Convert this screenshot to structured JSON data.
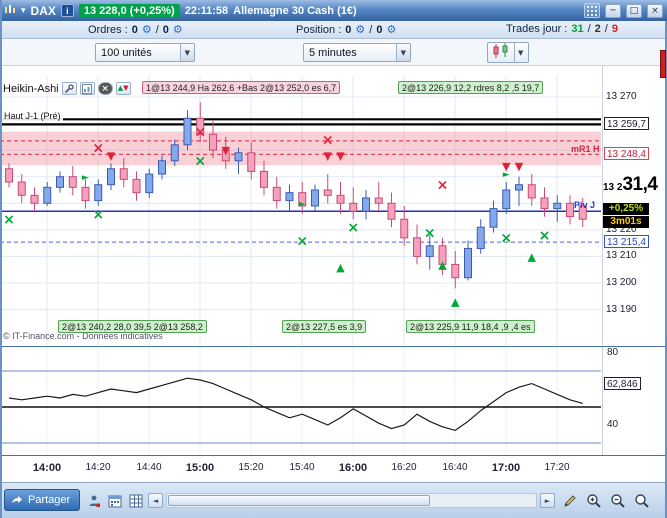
{
  "title_bar": {
    "instrument": "DAX",
    "price_badge": "13 228,0 (+0,25%)",
    "session_time": "22:11:58",
    "instrument_desc": "Allemagne 30 Cash (1€)"
  },
  "orders_bar": {
    "orders_label": "Ordres :",
    "orders_buy": "0",
    "orders_sell": "0",
    "position_label": "Position :",
    "position_buy": "0",
    "position_sell": "0",
    "trades_label": "Trades jour :",
    "trades_win": "31",
    "trades_mid": "2",
    "trades_loss": "9",
    "sep": "/"
  },
  "control_bar": {
    "units_value": "100 unités",
    "timeframe_value": "5 minutes"
  },
  "chart": {
    "study_label": "Heikin-Ashi",
    "top_chip_pink": "1@13 244,9 Ha 262,6 +Bas 2@13 252,0 es 6,7",
    "top_chip_green": "2@13 226,9 12,2 rdres 8,2 ,5 19,7",
    "prev_high_label": "Haut J-1 (Pré)",
    "mr1_label": "mR1 H",
    "pivot_label": "Piv J",
    "order_chips": [
      "2@13 240,2 28,0 39,5 2@13 258,2",
      "2@13 227,5 es 3,9",
      "2@13 225,9 11,9 18,4 ,9 ,4 es"
    ],
    "copyright": "© IT-Finance.com - Données indicatives"
  },
  "price_axis": {
    "labels": [
      {
        "text": "13 270",
        "price": 13270,
        "style": "plain"
      },
      {
        "text": "13 259,7",
        "price": 13259.7,
        "style": "box-dark"
      },
      {
        "text": "13 248,4",
        "price": 13248.4,
        "style": "box-red"
      },
      {
        "text": "13 220",
        "price": 13220,
        "style": "plain"
      },
      {
        "text": "13 215,4",
        "price": 13215.4,
        "style": "box-blue"
      },
      {
        "text": "13 210",
        "price": 13210,
        "style": "plain"
      },
      {
        "text": "13 200",
        "price": 13200,
        "style": "plain"
      },
      {
        "text": "13 190",
        "price": 13190,
        "style": "plain"
      }
    ],
    "current": {
      "prefix": "13 2",
      "big": "31,4",
      "change": "+0,25%",
      "countdown": "3m01s",
      "price": 13231.4
    }
  },
  "indicator_panel": {
    "labels": [
      {
        "text": "80",
        "value": 80,
        "style": "plain"
      },
      {
        "text": "62,846",
        "value": 62.846,
        "style": "box"
      },
      {
        "text": "40",
        "value": 40,
        "style": "plain"
      }
    ]
  },
  "time_axis": [
    "14:00",
    "14:20",
    "14:40",
    "15:00",
    "15:20",
    "15:40",
    "16:00",
    "16:20",
    "16:40",
    "17:00",
    "17:20"
  ],
  "bottom_toolbar": {
    "share_label": "Partager"
  },
  "icons": {
    "caret_down": "▾",
    "chevron_down": "▼",
    "scroll_left": "◄",
    "scroll_right": "►",
    "minimize": "─",
    "maximize": "□",
    "close": "×",
    "gear": "⚙",
    "info_letter": "i",
    "study_close": "×",
    "arrow_up": "▲",
    "arrow_down": "▼"
  },
  "colors": {
    "candle_up_fill": "#84a8ec",
    "candle_up_stroke": "#3c5cb4",
    "candle_down_fill": "#f4a2bc",
    "candle_down_stroke": "#cc4878",
    "zone_fill": "#f0657a",
    "level_black": "#000000",
    "level_red": "#e04858",
    "level_blue": "#2030c0",
    "level_blue_dash": "#4868d8",
    "marker_green": "#00a838",
    "marker_red": "#e02238",
    "grid": "#e0e8f2",
    "oscillator_line": "#1a1a1a",
    "oscillator_band": "#7088cc",
    "badge_green": "#00a14b"
  },
  "chart_data": {
    "type": "candlestick",
    "study": "Heikin-Ashi",
    "timeframe": "5 minutes",
    "x_start_time": "13:45",
    "ylim": [
      13177,
      13282
    ],
    "h_gridlines": [
      13270,
      13260,
      13250,
      13240,
      13230,
      13220,
      13210,
      13200,
      13190
    ],
    "zone": {
      "top": 13257.0,
      "bottom": 13244.3
    },
    "levels": [
      {
        "price": 13261.6,
        "style": "black"
      },
      {
        "price": 13259.7,
        "style": "black"
      },
      {
        "price": 13253.5,
        "style": "red-dash"
      },
      {
        "price": 13248.4,
        "style": "red-dash"
      },
      {
        "price": 13227.0,
        "style": "blue"
      },
      {
        "price": 13215.4,
        "style": "blue-dash"
      }
    ],
    "candles": [
      [
        13243,
        13245,
        13236,
        13238
      ],
      [
        13238,
        13241,
        13230,
        13233
      ],
      [
        13233,
        13236,
        13227,
        13230
      ],
      [
        13230,
        13238,
        13229,
        13236
      ],
      [
        13236,
        13242,
        13234,
        13240
      ],
      [
        13240,
        13244,
        13233,
        13236
      ],
      [
        13236,
        13239,
        13228,
        13231
      ],
      [
        13231,
        13239,
        13229,
        13237
      ],
      [
        13237,
        13245,
        13235,
        13243
      ],
      [
        13243,
        13247,
        13236,
        13239
      ],
      [
        13239,
        13242,
        13231,
        13234
      ],
      [
        13234,
        13243,
        13232,
        13241
      ],
      [
        13241,
        13248,
        13239,
        13246
      ],
      [
        13246,
        13254,
        13244,
        13252
      ],
      [
        13252,
        13265,
        13250,
        13262
      ],
      [
        13262,
        13268,
        13253,
        13256
      ],
      [
        13256,
        13261,
        13247,
        13250
      ],
      [
        13250,
        13255,
        13243,
        13246
      ],
      [
        13246,
        13251,
        13241,
        13249
      ],
      [
        13249,
        13253,
        13239,
        13242
      ],
      [
        13242,
        13246,
        13233,
        13236
      ],
      [
        13236,
        13240,
        13228,
        13231
      ],
      [
        13231,
        13237,
        13227,
        13234
      ],
      [
        13234,
        13238,
        13226,
        13229
      ],
      [
        13229,
        13237,
        13227,
        13235
      ],
      [
        13235,
        13241,
        13230,
        13233
      ],
      [
        13233,
        13238,
        13226,
        13230
      ],
      [
        13230,
        13236,
        13224,
        13227
      ],
      [
        13227,
        13235,
        13224,
        13232
      ],
      [
        13232,
        13238,
        13227,
        13230
      ],
      [
        13230,
        13234,
        13221,
        13224
      ],
      [
        13224,
        13229,
        13214,
        13217
      ],
      [
        13217,
        13222,
        13207,
        13210
      ],
      [
        13210,
        13218,
        13205,
        13214
      ],
      [
        13214,
        13217,
        13203,
        13207
      ],
      [
        13207,
        13212,
        13198,
        13202
      ],
      [
        13202,
        13216,
        13201,
        13213
      ],
      [
        13213,
        13224,
        13211,
        13221
      ],
      [
        13221,
        13231,
        13219,
        13228
      ],
      [
        13228,
        13238,
        13226,
        13235
      ],
      [
        13235,
        13240,
        13229,
        13237
      ],
      [
        13237,
        13241,
        13229,
        13232
      ],
      [
        13232,
        13236,
        13225,
        13228
      ],
      [
        13228,
        13233,
        13223,
        13230
      ],
      [
        13230,
        13233,
        13222,
        13225
      ],
      [
        13229,
        13232,
        13221,
        13224
      ]
    ],
    "markers": [
      [
        0,
        13224,
        "gx"
      ],
      [
        6,
        13240,
        "grt"
      ],
      [
        7,
        13226,
        "gx"
      ],
      [
        7,
        13251,
        "rx"
      ],
      [
        8,
        13248,
        "rdn"
      ],
      [
        15,
        13257,
        "rx"
      ],
      [
        15,
        13246,
        "gx"
      ],
      [
        17,
        13250,
        "rdn"
      ],
      [
        23,
        13230,
        "grt"
      ],
      [
        23,
        13216,
        "gx"
      ],
      [
        25,
        13254,
        "rx"
      ],
      [
        25,
        13248,
        "rdn"
      ],
      [
        26,
        13248,
        "rdn"
      ],
      [
        26,
        13206,
        "gup"
      ],
      [
        27,
        13221,
        "gx"
      ],
      [
        33,
        13219,
        "gx"
      ],
      [
        34,
        13237,
        "rx"
      ],
      [
        34,
        13207,
        "gup"
      ],
      [
        35,
        13193,
        "gup"
      ],
      [
        39,
        13244,
        "rdn"
      ],
      [
        40,
        13244,
        "rdn"
      ],
      [
        39,
        13241,
        "grt"
      ],
      [
        39,
        13217,
        "gx"
      ],
      [
        41,
        13210,
        "gup"
      ],
      [
        42,
        13218,
        "gx"
      ]
    ],
    "oscillator": {
      "values": [
        55,
        54,
        55,
        56,
        55,
        57,
        56,
        58,
        60,
        59,
        58,
        60,
        62,
        64,
        66,
        65,
        63,
        60,
        57,
        54,
        50,
        47,
        44,
        46,
        43,
        40,
        44,
        49,
        45,
        41,
        38,
        40,
        46,
        42,
        39,
        37,
        42,
        48,
        53,
        58,
        61,
        63,
        60,
        57,
        54,
        52
      ],
      "levels": [
        70,
        50,
        30
      ],
      "last_value": 62.846,
      "range_labels": [
        80,
        40
      ]
    }
  }
}
